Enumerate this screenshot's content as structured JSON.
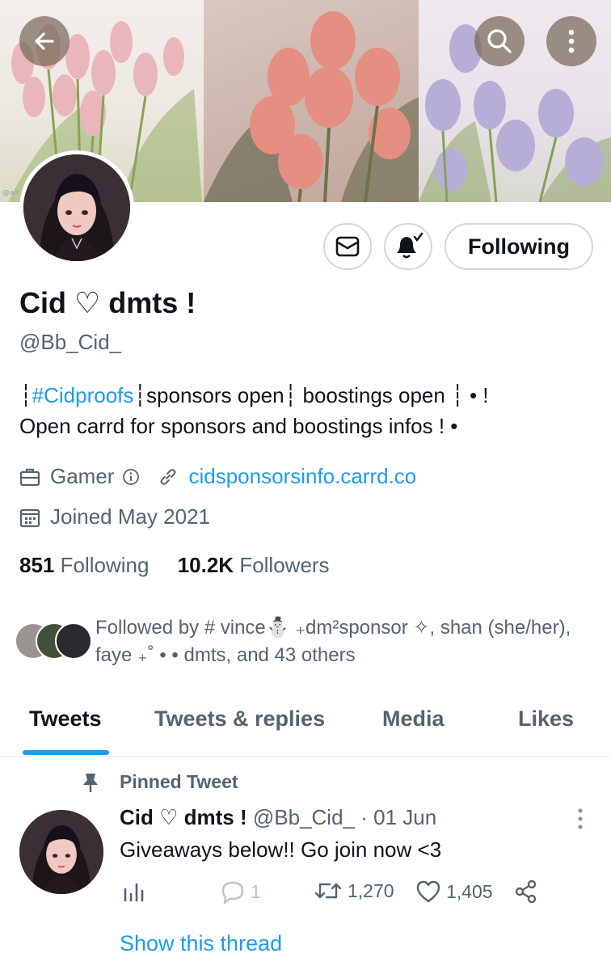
{
  "banner": {
    "credit": "@air",
    "back_icon": "arrow-left-icon",
    "search_icon": "search-icon",
    "more_icon": "more-vertical-icon"
  },
  "profile": {
    "name": "Cid ♡ dmts !",
    "handle": "@Bb_Cid_",
    "bio_line1_pre": "┆",
    "bio_hashtag": "#Cidproofs",
    "bio_line1_post": "┆sponsors open┆ boostings open ┆ • !",
    "bio_line2": "Open carrd for sponsors and boostings infos ! •",
    "category": "Gamer",
    "website": "cidsponsorsinfo.carrd.co",
    "joined": "Joined May 2021",
    "following_count": "851",
    "following_label": "Following",
    "followers_count": "10.2K",
    "followers_label": "Followers",
    "followed_by": "Followed by # vince⛄ ₊dm²sponsor ✧, shan (she/her), faye ₊˚ • • dmts, and 43 others"
  },
  "actions": {
    "message_icon": "envelope-icon",
    "notify_icon": "bell-check-icon",
    "follow_label": "Following"
  },
  "tabs": [
    {
      "label": "Tweets",
      "active": true
    },
    {
      "label": "Tweets & replies",
      "active": false
    },
    {
      "label": "Media",
      "active": false
    },
    {
      "label": "Likes",
      "active": false
    }
  ],
  "tweet": {
    "pinned_label": "Pinned Tweet",
    "author_name": "Cid ♡ dmts !",
    "author_handle": "@Bb_Cid_",
    "separator": "·",
    "date": "01 Jun",
    "text": "Giveaways below!! Go join now <3",
    "reply_count": "1",
    "retweet_count": "1,270",
    "like_count": "1,405",
    "show_thread": "Show this thread"
  },
  "colors": {
    "accent": "#1d9bf0",
    "text_primary": "#0f1419",
    "text_secondary": "#536471",
    "border": "#cfd9de"
  }
}
